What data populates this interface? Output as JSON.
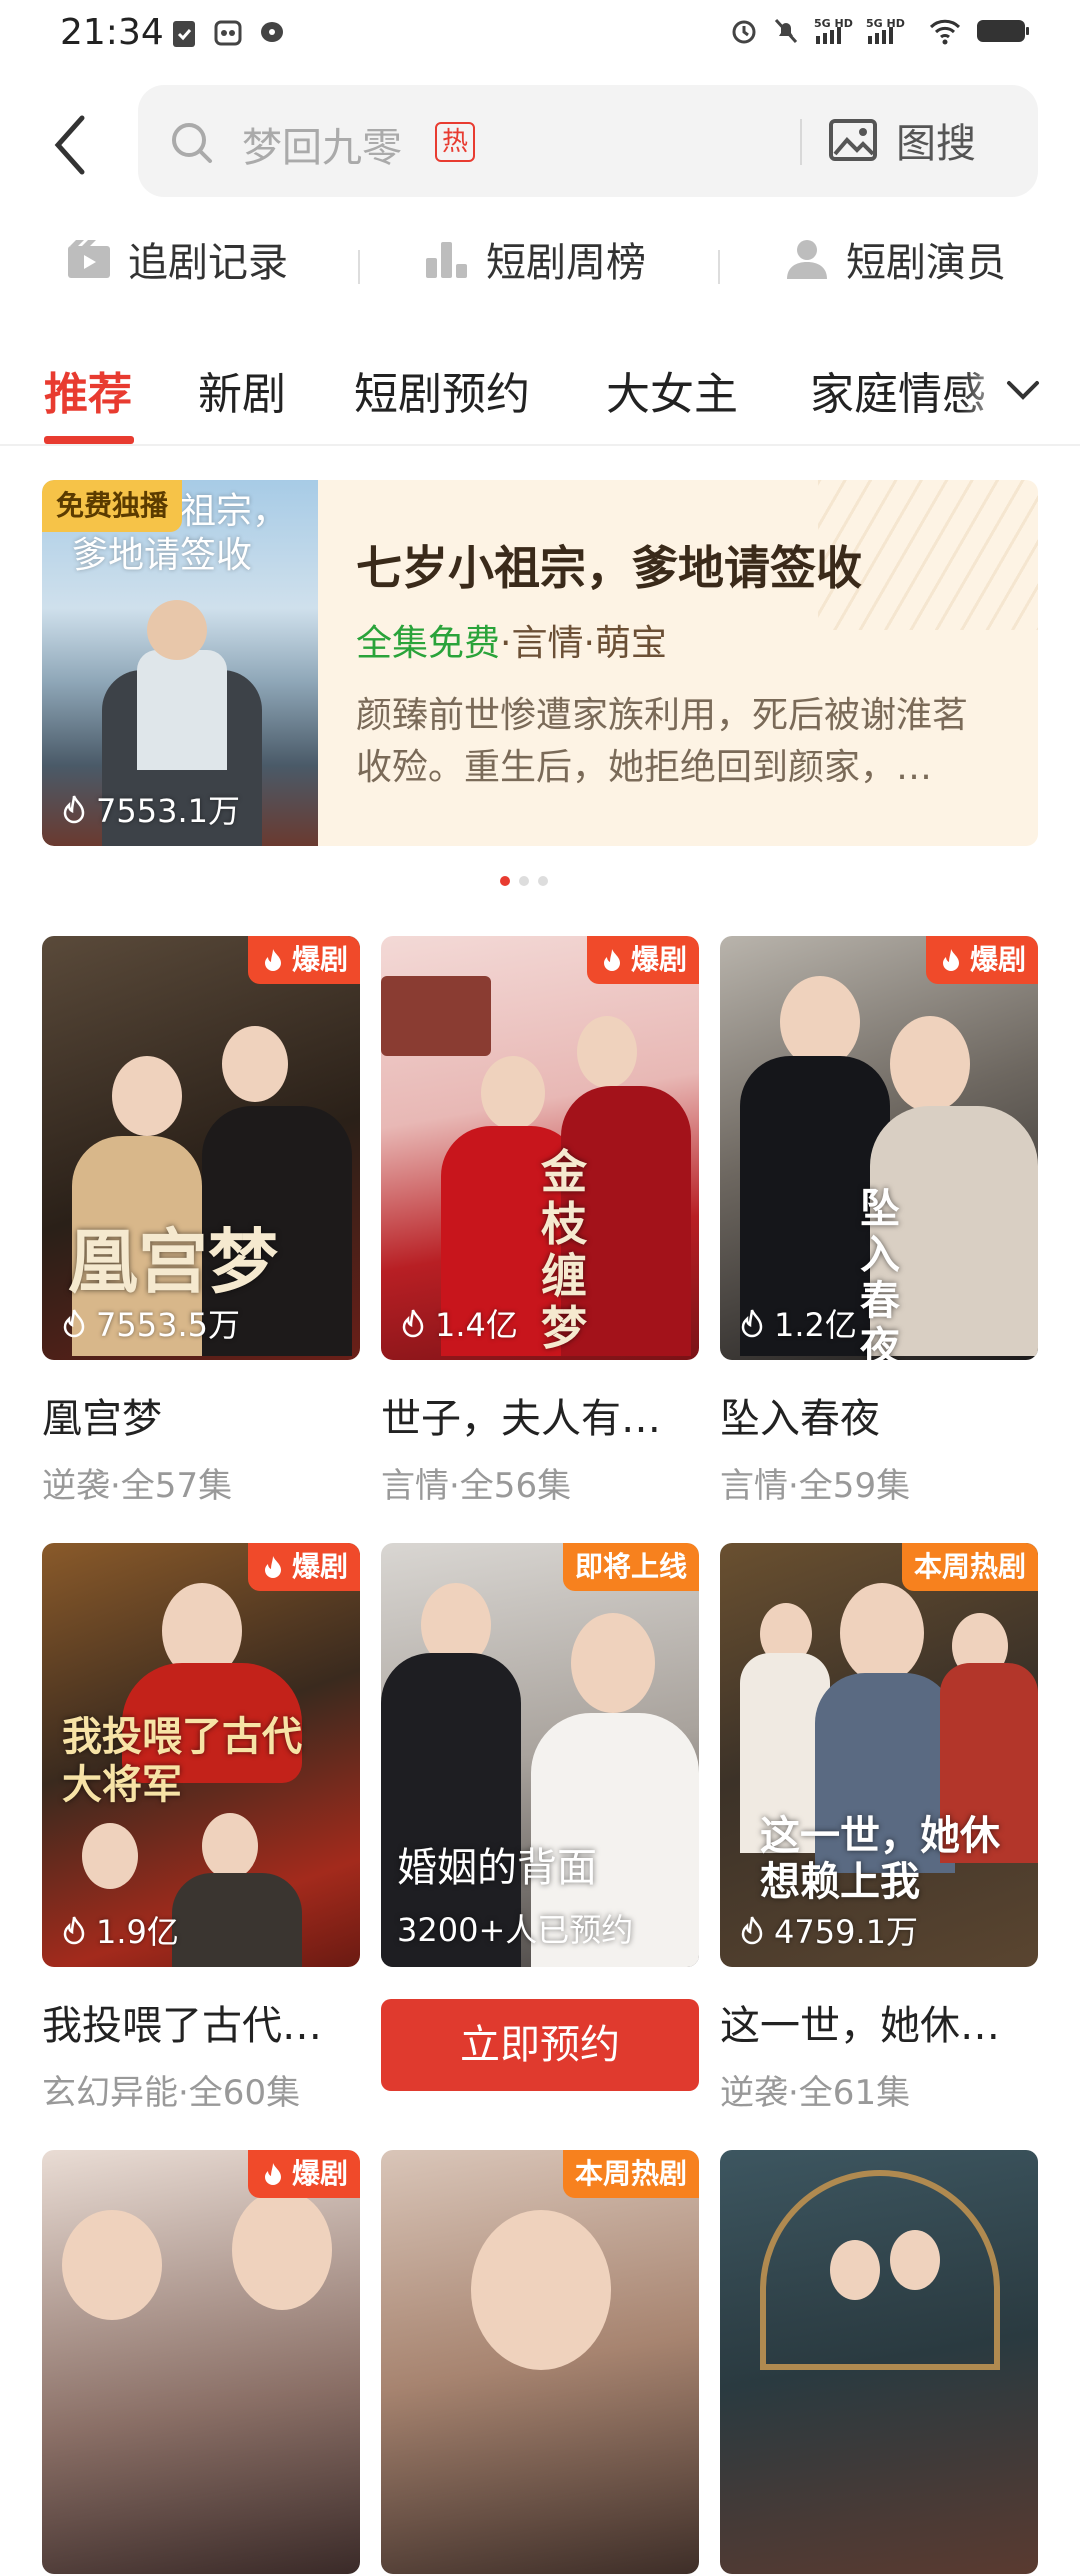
{
  "status_bar": {
    "time": "21:34",
    "network": "5G HD 5G HD"
  },
  "search": {
    "placeholder": "梦回九零",
    "hot_badge": "热",
    "image_search_label": "图搜"
  },
  "shortcuts": [
    {
      "label": "追剧记录",
      "icon": "tv-history-icon"
    },
    {
      "label": "短剧周榜",
      "icon": "bar-chart-icon"
    },
    {
      "label": "短剧演员",
      "icon": "person-icon"
    }
  ],
  "tabs": [
    {
      "label": "推荐",
      "active": true
    },
    {
      "label": "新剧"
    },
    {
      "label": "短剧预约"
    },
    {
      "label": "大女主"
    },
    {
      "label": "家庭情感"
    }
  ],
  "banner": {
    "badge": "免费独播",
    "poster_text": "七岁小祖宗，爹地请签收",
    "count": "7553.1万",
    "title": "七岁小祖宗，爹地请签收",
    "free": "全集免费",
    "tags": "·言情·萌宝",
    "description": "颜臻前世惨遭家族利用，死后被谢淮茗收殓。重生后，她拒绝回到颜家，…",
    "carousel": {
      "index": 1,
      "total": 3
    }
  },
  "cards": [
    {
      "title": "凰宫梦",
      "meta": "逆袭·全57集",
      "badge": "爆剧",
      "count": "7553.5万",
      "poster_text": "凰宫梦"
    },
    {
      "title": "世子，夫人有…",
      "meta": "言情·全56集",
      "badge": "爆剧",
      "count": "1.4亿",
      "poster_text": "金枝缠梦"
    },
    {
      "title": "坠入春夜",
      "meta": "言情·全59集",
      "badge": "爆剧",
      "count": "1.2亿",
      "poster_text": "坠入春夜"
    },
    {
      "title": "我投喂了古代…",
      "meta": "玄幻异能·全60集",
      "badge": "爆剧",
      "count": "1.9亿",
      "poster_text": "我投喂了古代大将军"
    },
    {
      "poster_title": "婚姻的背面",
      "reserve_count": "3200+人已预约",
      "badge": "即将上线",
      "button": "立即预约"
    },
    {
      "title": "这一世，她休…",
      "meta": "逆袭·全61集",
      "badge": "本周热剧",
      "count": "4759.1万",
      "poster_text": "这一世，她休想赖上我"
    },
    {
      "badge": "爆剧"
    },
    {
      "badge": "本周热剧"
    },
    {}
  ],
  "colors": {
    "accent": "#e83b30",
    "hot_badge": "#f04a2a",
    "orange_badge": "#f7811e",
    "free_green": "#2aa33a"
  }
}
